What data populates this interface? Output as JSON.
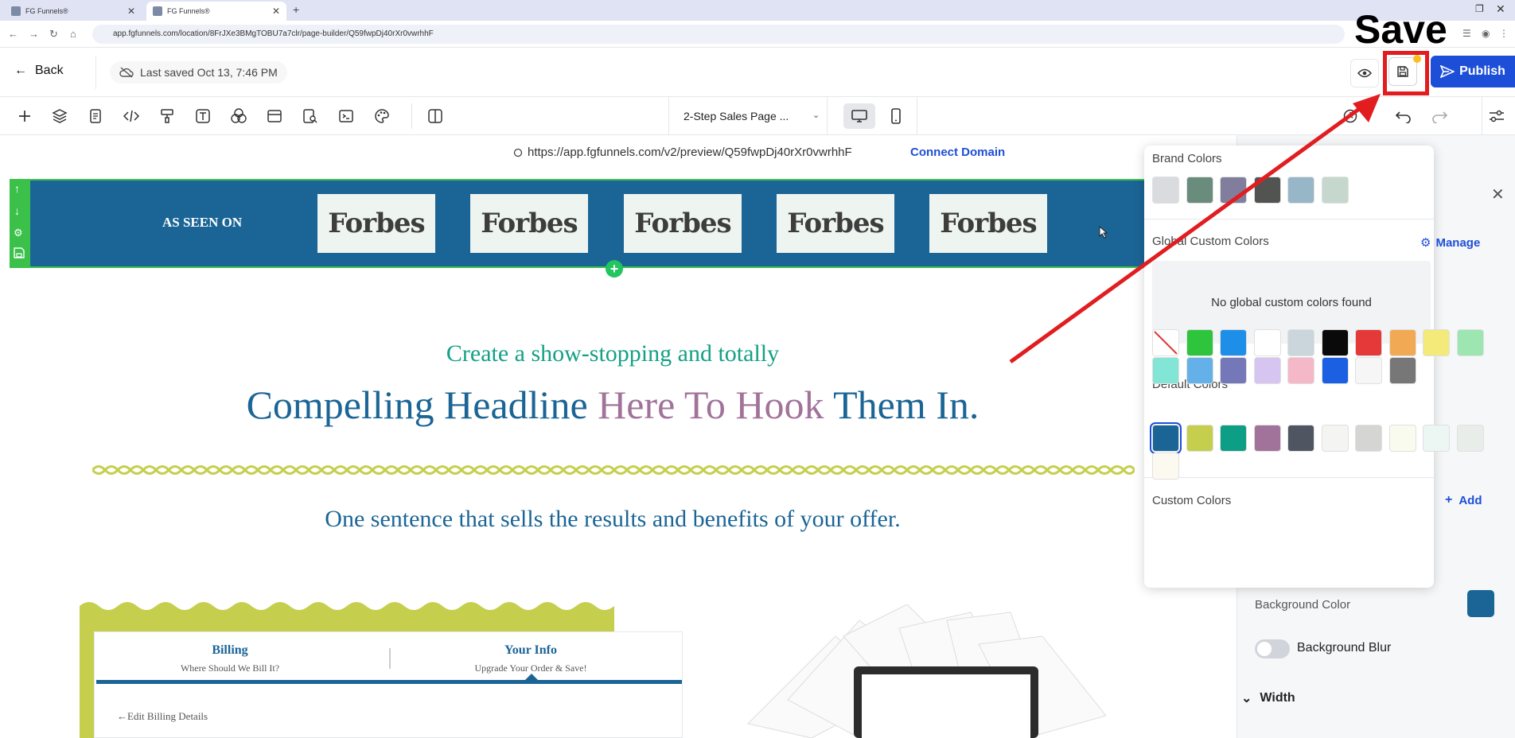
{
  "browser": {
    "tabs": [
      {
        "title": "FG Funnels®",
        "active": false
      },
      {
        "title": "FG Funnels®",
        "active": true
      }
    ],
    "url": "app.fgfunnels.com/location/8FrJXe3BMgTOBU7a7clr/page-builder/Q59fwpDj40rXr0vwrhhF"
  },
  "topbar": {
    "back_label": "Back",
    "last_saved": "Last saved Oct 13, 7:46 PM",
    "publish_label": "Publish"
  },
  "toolbar": {
    "page_select": "2-Step Sales Page ...",
    "icons": [
      "plus-icon",
      "layers-icon",
      "page-icon",
      "code-icon",
      "paint-roller-icon",
      "text-icon",
      "circles-icon",
      "browser-window-icon",
      "search-doc-icon",
      "terminal-icon",
      "palette-icon",
      "split-view-icon"
    ]
  },
  "preview": {
    "url": "https://app.fgfunnels.com/v2/preview/Q59fwpDj40rXr0vwrhhF",
    "connect_domain": "Connect Domain"
  },
  "page": {
    "as_seen_on": "AS SEEN ON",
    "logos": [
      "Forbes",
      "Forbes",
      "Forbes",
      "Forbes",
      "Forbes"
    ],
    "subheadline": "Create a show-stopping and totally",
    "headline_part1": "Compelling Headline ",
    "headline_accent": "Here To Hook",
    "headline_part2": " Them In.",
    "offer_line": "One sentence that sells the results and benefits of your offer.",
    "steps": [
      {
        "title": "Billing",
        "subtitle": "Where Should We Bill It?"
      },
      {
        "title": "Your Info",
        "subtitle": "Upgrade Your Order & Save!"
      }
    ],
    "edit_billing": "Edit Billing Details"
  },
  "color_picker": {
    "brand_title": "Brand Colors",
    "brand_colors": [
      "#d9dbde",
      "#6a8c7c",
      "#807e9c",
      "#525452",
      "#97b6c8",
      "#c6d8cd"
    ],
    "global_title": "Global Custom Colors",
    "manage_label": "Manage",
    "no_global": "No global custom colors found",
    "default_title": "Default Colors",
    "default_colors": [
      "none",
      "#2ec43e",
      "#1e8fe8",
      "#ffffff",
      "#cbd6dc",
      "#0a0a0a",
      "#e53838",
      "#f2a954",
      "#f3ea79",
      "#9de6b1",
      "#83e5d6",
      "#63b1e8",
      "#7478b8",
      "#d7c5f1",
      "#f5b8c9",
      "#1b5fe3",
      "#f5f6f5",
      "#777777"
    ],
    "custom_title": "Custom Colors",
    "add_label": "Add",
    "custom_colors": [
      "#1b6596",
      "#c5cf4d",
      "#0d9e86",
      "#a2739a",
      "#4f5561",
      "#f4f5f3",
      "#d5d6d4",
      "#f9fbef",
      "#ecf6f2",
      "#e9edea",
      "#fbf9f0"
    ]
  },
  "settings": {
    "background_color_label": "Background Color",
    "background_color": "#1b6596",
    "background_blur_label": "Background Blur",
    "width_label": "Width"
  },
  "annotation": {
    "callout": "Save"
  }
}
